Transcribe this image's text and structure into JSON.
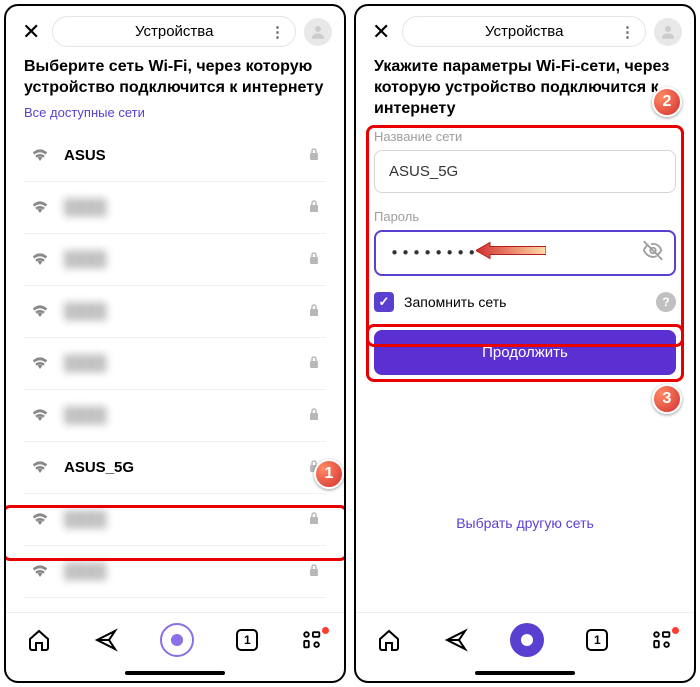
{
  "header": {
    "title": "Устройства"
  },
  "left": {
    "heading": "Выберите сеть Wi-Fi, через которую устройство подключится к интернету",
    "subhead": "Все доступные сети",
    "networks": [
      {
        "name": "ASUS",
        "visible": true
      },
      {
        "name": "net2",
        "visible": false
      },
      {
        "name": "net3",
        "visible": false
      },
      {
        "name": "net4",
        "visible": false
      },
      {
        "name": "net5",
        "visible": false
      },
      {
        "name": "net6",
        "visible": false
      },
      {
        "name": "ASUS_5G",
        "visible": true
      },
      {
        "name": "net8",
        "visible": false
      },
      {
        "name": "net9",
        "visible": false
      }
    ]
  },
  "right": {
    "heading": "Укажите параметры Wi-Fi-сети, через которую устройство подключится к интернету",
    "ssid_label": "Название сети",
    "ssid_value": "ASUS_5G",
    "password_label": "Пароль",
    "password_value": "•••••••••",
    "remember": "Запомнить сеть",
    "continue": "Продолжить",
    "other_link": "Выбрать другую сеть"
  },
  "nav": {
    "tab_count": "1"
  },
  "badges": {
    "b1": "1",
    "b2": "2",
    "b3": "3"
  }
}
